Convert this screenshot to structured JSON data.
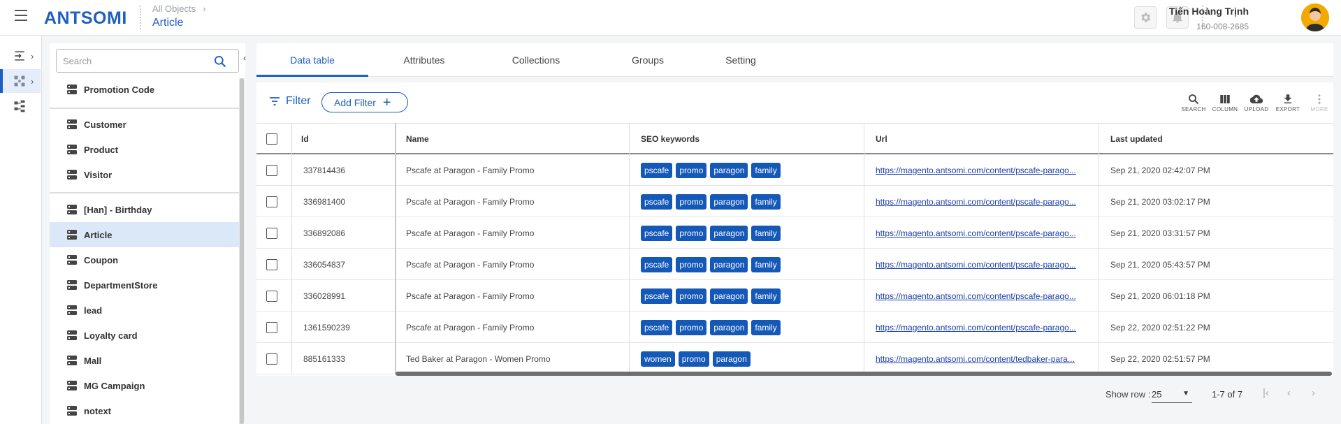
{
  "header": {
    "logo": "ANTSOMI",
    "breadcrumb_parent": "All Objects",
    "breadcrumb_current": "Article",
    "user_name": "Tiến Hoàng Trịnh",
    "user_id": "160-008-2685"
  },
  "objects": {
    "search_placeholder": "Search",
    "items": [
      {
        "label": "Promotion Code"
      },
      {
        "label": "Customer"
      },
      {
        "label": "Product"
      },
      {
        "label": "Visitor"
      },
      {
        "label": "[Han] - Birthday"
      },
      {
        "label": "Article",
        "active": true
      },
      {
        "label": "Coupon"
      },
      {
        "label": "DepartmentStore"
      },
      {
        "label": "lead"
      },
      {
        "label": "Loyalty card"
      },
      {
        "label": "Mall"
      },
      {
        "label": "MG Campaign"
      },
      {
        "label": "notext"
      }
    ]
  },
  "tabs": [
    "Data table",
    "Attributes",
    "Collections",
    "Groups",
    "Setting"
  ],
  "toolbar": {
    "filter_label": "Filter",
    "add_filter_label": "Add Filter",
    "tools": [
      "SEARCH",
      "COLUMN",
      "UPLOAD",
      "EXPORT",
      "MORE"
    ]
  },
  "table": {
    "columns": [
      "Id",
      "Name",
      "SEO keywords",
      "Url",
      "Last updated"
    ],
    "rows": [
      {
        "id": "337814436",
        "name": "Pscafe at Paragon - Family Promo",
        "tags": [
          "pscafe",
          "promo",
          "paragon",
          "family"
        ],
        "url": "https://magento.antsomi.com/content/pscafe-parago...",
        "updated": "Sep 21, 2020 02:42:07 PM"
      },
      {
        "id": "336981400",
        "name": "Pscafe at Paragon - Family Promo",
        "tags": [
          "pscafe",
          "promo",
          "paragon",
          "family"
        ],
        "url": "https://magento.antsomi.com/content/pscafe-parago...",
        "updated": "Sep 21, 2020 03:02:17 PM"
      },
      {
        "id": "336892086",
        "name": "Pscafe at Paragon - Family Promo",
        "tags": [
          "pscafe",
          "promo",
          "paragon",
          "family"
        ],
        "url": "https://magento.antsomi.com/content/pscafe-parago...",
        "updated": "Sep 21, 2020 03:31:57 PM"
      },
      {
        "id": "336054837",
        "name": "Pscafe at Paragon - Family Promo",
        "tags": [
          "pscafe",
          "promo",
          "paragon",
          "family"
        ],
        "url": "https://magento.antsomi.com/content/pscafe-parago...",
        "updated": "Sep 21, 2020 05:43:57 PM"
      },
      {
        "id": "336028991",
        "name": "Pscafe at Paragon - Family Promo",
        "tags": [
          "pscafe",
          "promo",
          "paragon",
          "family"
        ],
        "url": "https://magento.antsomi.com/content/pscafe-parago...",
        "updated": "Sep 21, 2020 06:01:18 PM"
      },
      {
        "id": "1361590239",
        "name": "Pscafe at Paragon - Family Promo",
        "tags": [
          "pscafe",
          "promo",
          "paragon",
          "family"
        ],
        "url": "https://magento.antsomi.com/content/pscafe-parago...",
        "updated": "Sep 22, 2020 02:51:22 PM"
      },
      {
        "id": "885161333",
        "name": "Ted Baker at Paragon - Women Promo",
        "tags": [
          "women",
          "promo",
          "paragon"
        ],
        "url": "https://magento.antsomi.com/content/tedbaker-para...",
        "updated": "Sep 22, 2020 02:51:57 PM"
      }
    ]
  },
  "pager": {
    "show_row_label": "Show row :",
    "page_size": "25",
    "range": "1-7 of 7"
  },
  "colors": {
    "accent": "#1f5fbf",
    "tag_bg": "#1458b8",
    "active_row": "#dbe8f8"
  }
}
